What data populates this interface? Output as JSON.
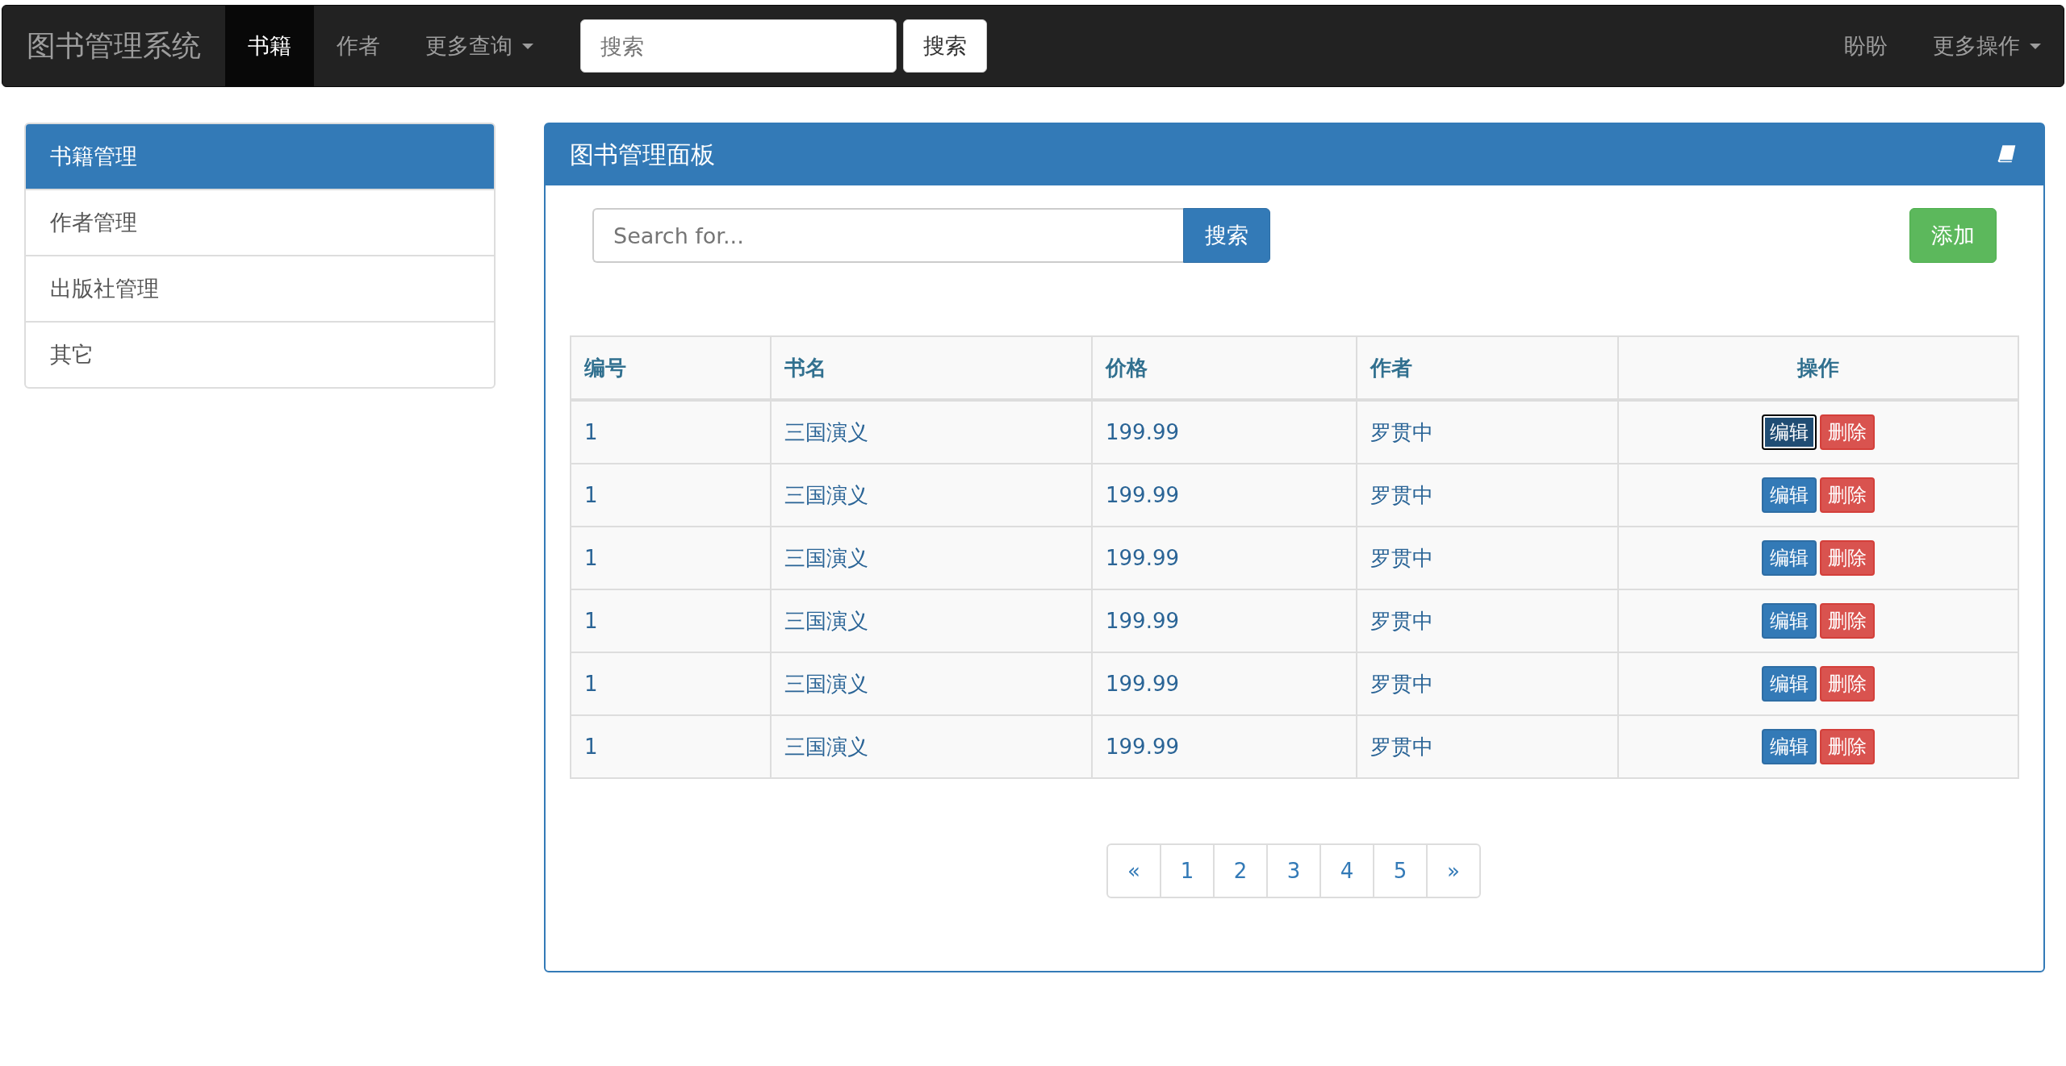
{
  "navbar": {
    "brand": "图书管理系统",
    "links": [
      {
        "label": "书籍",
        "selected": true,
        "dropdown": false
      },
      {
        "label": "作者",
        "selected": false,
        "dropdown": false
      },
      {
        "label": "更多查询",
        "selected": false,
        "dropdown": true
      }
    ],
    "search": {
      "placeholder": "搜索",
      "button": "搜索"
    },
    "right_links": [
      {
        "label": "盼盼",
        "dropdown": false
      },
      {
        "label": "更多操作",
        "dropdown": true
      }
    ]
  },
  "sidebar": {
    "items": [
      {
        "label": "书籍管理",
        "selected": true
      },
      {
        "label": "作者管理",
        "selected": false
      },
      {
        "label": "出版社管理",
        "selected": false
      },
      {
        "label": "其它",
        "selected": false
      }
    ]
  },
  "panel": {
    "title": "图书管理面板",
    "search": {
      "placeholder": "Search for...",
      "button": "搜索"
    },
    "add_button": "添加",
    "table": {
      "columns": [
        "编号",
        "书名",
        "价格",
        "作者",
        "操作"
      ],
      "rows": [
        {
          "id": "1",
          "title": "三国演义",
          "price": "199.99",
          "author": "罗贯中",
          "edit": "编辑",
          "delete": "删除",
          "edit_focused": true
        },
        {
          "id": "1",
          "title": "三国演义",
          "price": "199.99",
          "author": "罗贯中",
          "edit": "编辑",
          "delete": "删除",
          "edit_focused": false
        },
        {
          "id": "1",
          "title": "三国演义",
          "price": "199.99",
          "author": "罗贯中",
          "edit": "编辑",
          "delete": "删除",
          "edit_focused": false
        },
        {
          "id": "1",
          "title": "三国演义",
          "price": "199.99",
          "author": "罗贯中",
          "edit": "编辑",
          "delete": "删除",
          "edit_focused": false
        },
        {
          "id": "1",
          "title": "三国演义",
          "price": "199.99",
          "author": "罗贯中",
          "edit": "编辑",
          "delete": "删除",
          "edit_focused": false
        },
        {
          "id": "1",
          "title": "三国演义",
          "price": "199.99",
          "author": "罗贯中",
          "edit": "编辑",
          "delete": "删除",
          "edit_focused": false
        }
      ]
    },
    "pagination": [
      "«",
      "1",
      "2",
      "3",
      "4",
      "5",
      "»"
    ]
  }
}
